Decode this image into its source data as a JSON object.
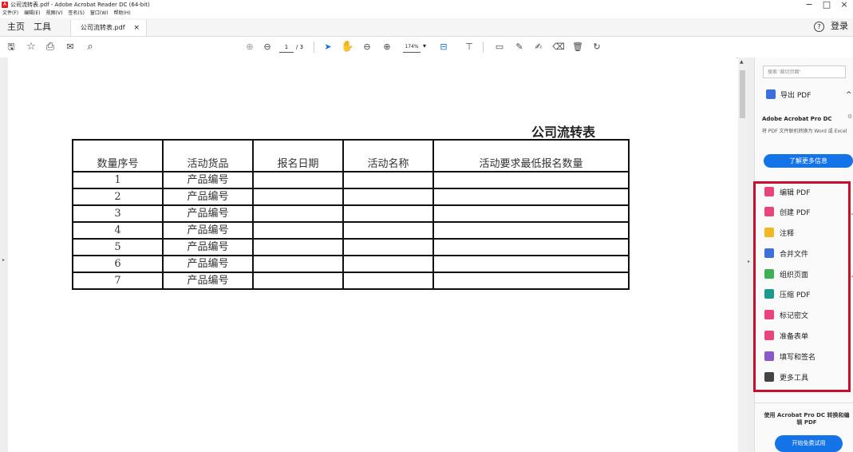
{
  "window": {
    "title": "公司流转表.pdf - Adobe Acrobat Reader DC (64-bit)",
    "controls": [
      "−",
      "□",
      "×"
    ]
  },
  "menubar": [
    "文件(F)",
    "编辑(E)",
    "视图(V)",
    "签名(S)",
    "窗口(W)",
    "帮助(H)"
  ],
  "tabs": {
    "home": "主页",
    "tools": "工具",
    "document": "公司流转表.pdf",
    "close": "×",
    "help": "?",
    "login": "登录"
  },
  "toolbar": {
    "page_current": "1",
    "page_total": "/ 3",
    "zoom": "174%"
  },
  "document": {
    "title": "公司流转表",
    "headers": [
      "数量序号",
      "活动货品",
      "报名日期",
      "活动名称",
      "活动要求最低报名数量"
    ],
    "rows": [
      [
        "1",
        "产品编号",
        "",
        "",
        ""
      ],
      [
        "2",
        "产品编号",
        "",
        "",
        ""
      ],
      [
        "3",
        "产品编号",
        "",
        "",
        ""
      ],
      [
        "4",
        "产品编号",
        "",
        "",
        ""
      ],
      [
        "5",
        "产品编号",
        "",
        "",
        ""
      ],
      [
        "6",
        "产品编号",
        "",
        "",
        ""
      ],
      [
        "7",
        "产品编号",
        "",
        "",
        ""
      ]
    ]
  },
  "right_panel": {
    "search_placeholder": "搜索 '裁切页面'",
    "export_pdf": "导出 PDF",
    "promo_title": "Adobe Acrobat Pro DC",
    "promo_desc": "将 PDF 文件联机转换为 Word 或 Excel",
    "learn_more": "了解更多信息",
    "tools": [
      {
        "label": "编辑 PDF",
        "color": "#e8457a"
      },
      {
        "label": "创建 PDF",
        "color": "#e8457a"
      },
      {
        "label": "注释",
        "color": "#f2b824"
      },
      {
        "label": "合并文件",
        "color": "#3d6fd8"
      },
      {
        "label": "组织页面",
        "color": "#3fae55"
      },
      {
        "label": "压缩 PDF",
        "color": "#1c9b8a"
      },
      {
        "label": "标记密文",
        "color": "#e8457a"
      },
      {
        "label": "准备表单",
        "color": "#e8457a"
      },
      {
        "label": "填写和签名",
        "color": "#8a59c7"
      },
      {
        "label": "更多工具",
        "color": "#444444"
      }
    ],
    "bottom_text": "使用 Acrobat Pro DC 转换和编辑 PDF",
    "trial_button": "开始免费试用"
  },
  "colors": {
    "accent_blue": "#1473e6",
    "highlight_red": "#c8102e"
  }
}
